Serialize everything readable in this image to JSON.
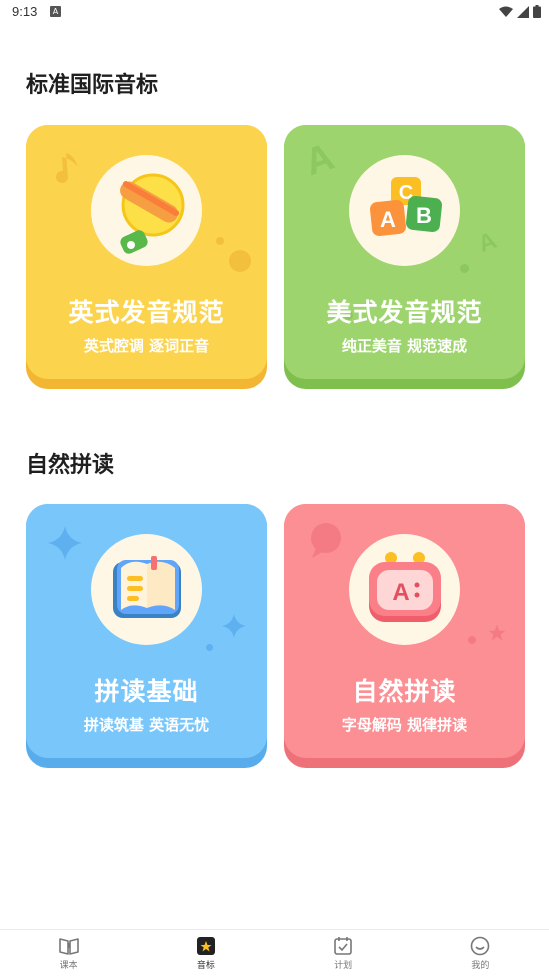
{
  "status_bar": {
    "time": "9:13"
  },
  "sections": [
    {
      "title": "标准国际音标"
    },
    {
      "title": "自然拼读"
    }
  ],
  "cards": [
    {
      "title": "英式发音规范",
      "subtitle": "英式腔调 逐词正音",
      "color": "#fcd34d",
      "shade": "#f2b632",
      "icon": "bell-icon"
    },
    {
      "title": "美式发音规范",
      "subtitle": "纯正美音 规范速成",
      "color": "#9dd46e",
      "shade": "#7fbf4e",
      "icon": "abc-blocks-icon"
    },
    {
      "title": "拼读基础",
      "subtitle": "拼读筑基 英语无忧",
      "color": "#79c7fa",
      "shade": "#58acec",
      "icon": "book-icon"
    },
    {
      "title": "自然拼读",
      "subtitle": "字母解码 规律拼读",
      "color": "#fb8f93",
      "shade": "#ee7179",
      "icon": "robot-a-icon"
    }
  ],
  "tabs": [
    {
      "label": "课本",
      "icon": "textbook-icon"
    },
    {
      "label": "音标",
      "icon": "phonetic-icon",
      "active": true
    },
    {
      "label": "计划",
      "icon": "calendar-check-icon"
    },
    {
      "label": "我的",
      "icon": "smiley-icon"
    }
  ]
}
